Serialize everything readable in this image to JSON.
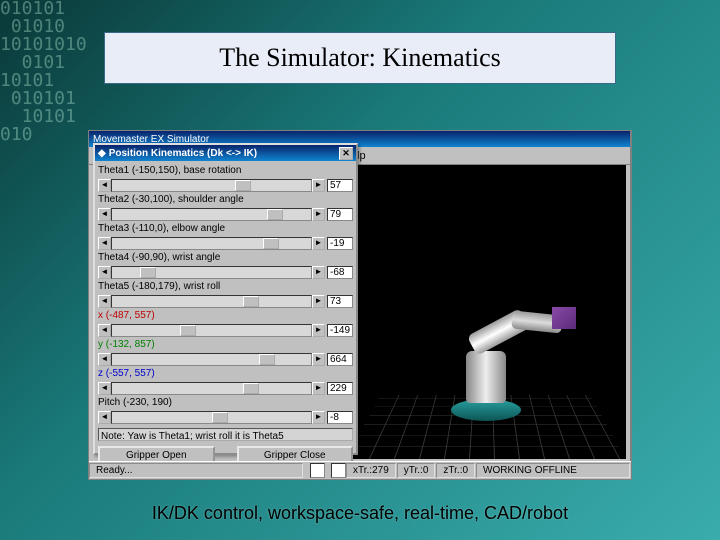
{
  "slide": {
    "title": "The Simulator: Kinematics",
    "caption": "IK/DK control, workspace-safe, real-time, CAD/robot"
  },
  "bg_noise": "010101\n 01010\n10101010\n  0101\n10101\n 010101\n  10101\n010",
  "outer_window": {
    "title": "Movemaster EX Simulator",
    "menu": [
      "",
      "",
      "",
      "",
      "Help"
    ]
  },
  "kin_window": {
    "title": "Position Kinematics (Dk <-> IK)",
    "rows": [
      {
        "label": "Theta1 (-150,150), base rotation",
        "value": "57",
        "thumb": 62
      },
      {
        "label": "Theta2 (-30,100), shoulder angle",
        "value": "79",
        "thumb": 78
      },
      {
        "label": "Theta3 (-110,0), elbow angle",
        "value": "-19",
        "thumb": 76
      },
      {
        "label": "Theta4 (-90,90), wrist angle",
        "value": "-68",
        "thumb": 14
      },
      {
        "label": "Theta5 (-180,179), wrist roll",
        "value": "73",
        "thumb": 66
      },
      {
        "label": "x (-487, 557)",
        "cls": "red",
        "value": "-149",
        "thumb": 34
      },
      {
        "label": "y (-132, 857)",
        "cls": "grn",
        "value": "664",
        "thumb": 74
      },
      {
        "label": "z (-557, 557)",
        "cls": "blu",
        "value": "229",
        "thumb": 66
      },
      {
        "label": "Pitch (-230, 190)",
        "value": "-8",
        "thumb": 50
      }
    ],
    "note": "Note: Yaw is Theta1; wrist roll it is Theta5",
    "gripper_open": "Gripper Open",
    "gripper_close": "Gripper Close"
  },
  "status": {
    "ready": "Ready...",
    "xtr": "xTr.:279",
    "ytr": "yTr.:0",
    "ztr": "zTr.:0",
    "mode": "WORKING OFFLINE"
  }
}
